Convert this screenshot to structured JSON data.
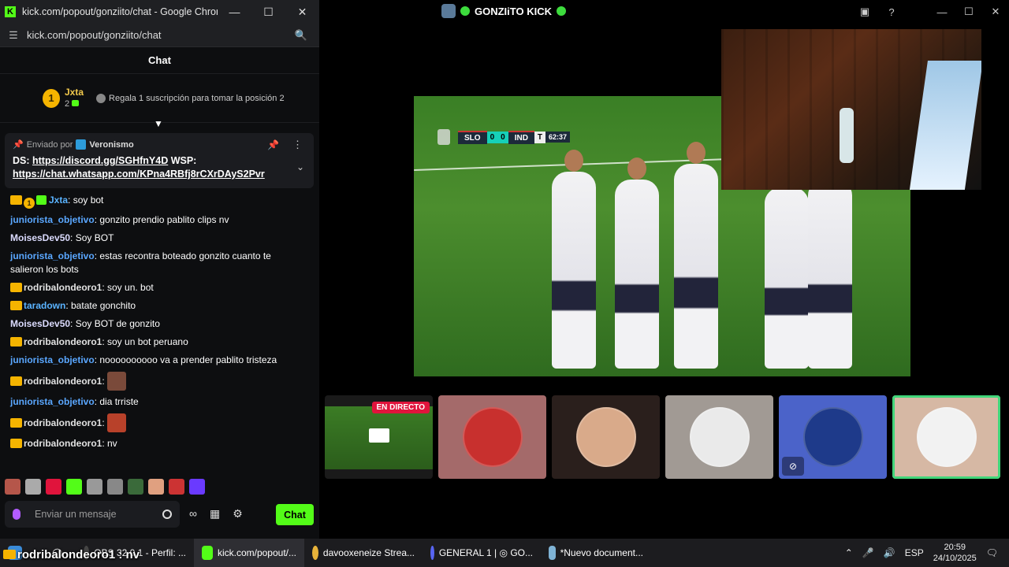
{
  "chrome": {
    "title": "kick.com/popout/gonziito/chat - Google Chrome",
    "url": "kick.com/popout/gonziito/chat"
  },
  "chat": {
    "header": "Chat",
    "leader": {
      "position": "1",
      "name": "Jxta",
      "count": "2",
      "gift_prompt": "Regala 1 suscripción para tomar la posición 2"
    },
    "pinned": {
      "sent_by_label": "Enviado por",
      "sender": "Veronismo",
      "line1_prefix": "DS: ",
      "line1_link": "https://discord.gg/SGHfnY4D",
      "line1_suffix": " WSP:",
      "line2_link": "https://chat.whatsapp.com/KPna4RBfj8rCXrDAyS2Pvr"
    },
    "messages": [
      {
        "user": "Jxta",
        "text": ": soy bot"
      },
      {
        "user": "juniorista_objetivo",
        "text": ": gonzito prendio pablito clips nv"
      },
      {
        "user": "MoisesDev50",
        "text": ": Soy BOT"
      },
      {
        "user": "juniorista_objetivo",
        "text": ": estas recontra boteado gonzito cuanto te salieron los bots"
      },
      {
        "user": "rodribalondeoro1",
        "text": ": soy un. bot"
      },
      {
        "user": "taradown",
        "text": ": batate gonchito"
      },
      {
        "user": "MoisesDev50",
        "text": ": Soy BOT de gonzito"
      },
      {
        "user": "rodribalondeoro1",
        "text": ": soy un bot peruano"
      },
      {
        "user": "juniorista_objetivo",
        "text": ": noooooooooo va a prender pablito tristeza"
      },
      {
        "user": "rodribalondeoro1",
        "text": ":"
      },
      {
        "user": "juniorista_objetivo",
        "text": ": dia trriste"
      },
      {
        "user": "rodribalondeoro1",
        "text": ":"
      },
      {
        "user": "rodribalondeoro1",
        "text": ": nv"
      }
    ],
    "input_placeholder": "Enviar un mensaje",
    "send_label": "Chat"
  },
  "studio": {
    "title": "GONZIiTO KICK",
    "scorebug": {
      "home": "SLO",
      "home_score": "0",
      "away_score": "0",
      "away": "IND",
      "tl": "T",
      "clock": "62:37"
    },
    "live_badge": "EN DIRECTO"
  },
  "taskbar": {
    "overlay_user": "rodribalondeoro1 : nv",
    "items": [
      "OBS 32.0.1 - Perfil: ...",
      "kick.com/popout/...",
      "davooxeneize Strea...",
      "GENERAL 1 | ◎ GO...",
      "*Nuevo document..."
    ],
    "lang": "ESP",
    "time": "20:59",
    "date": "24/10/2025"
  },
  "colors": {
    "kick_green": "#53fc18",
    "live_red": "#e0143c",
    "selected_outline": "#41d67a"
  }
}
